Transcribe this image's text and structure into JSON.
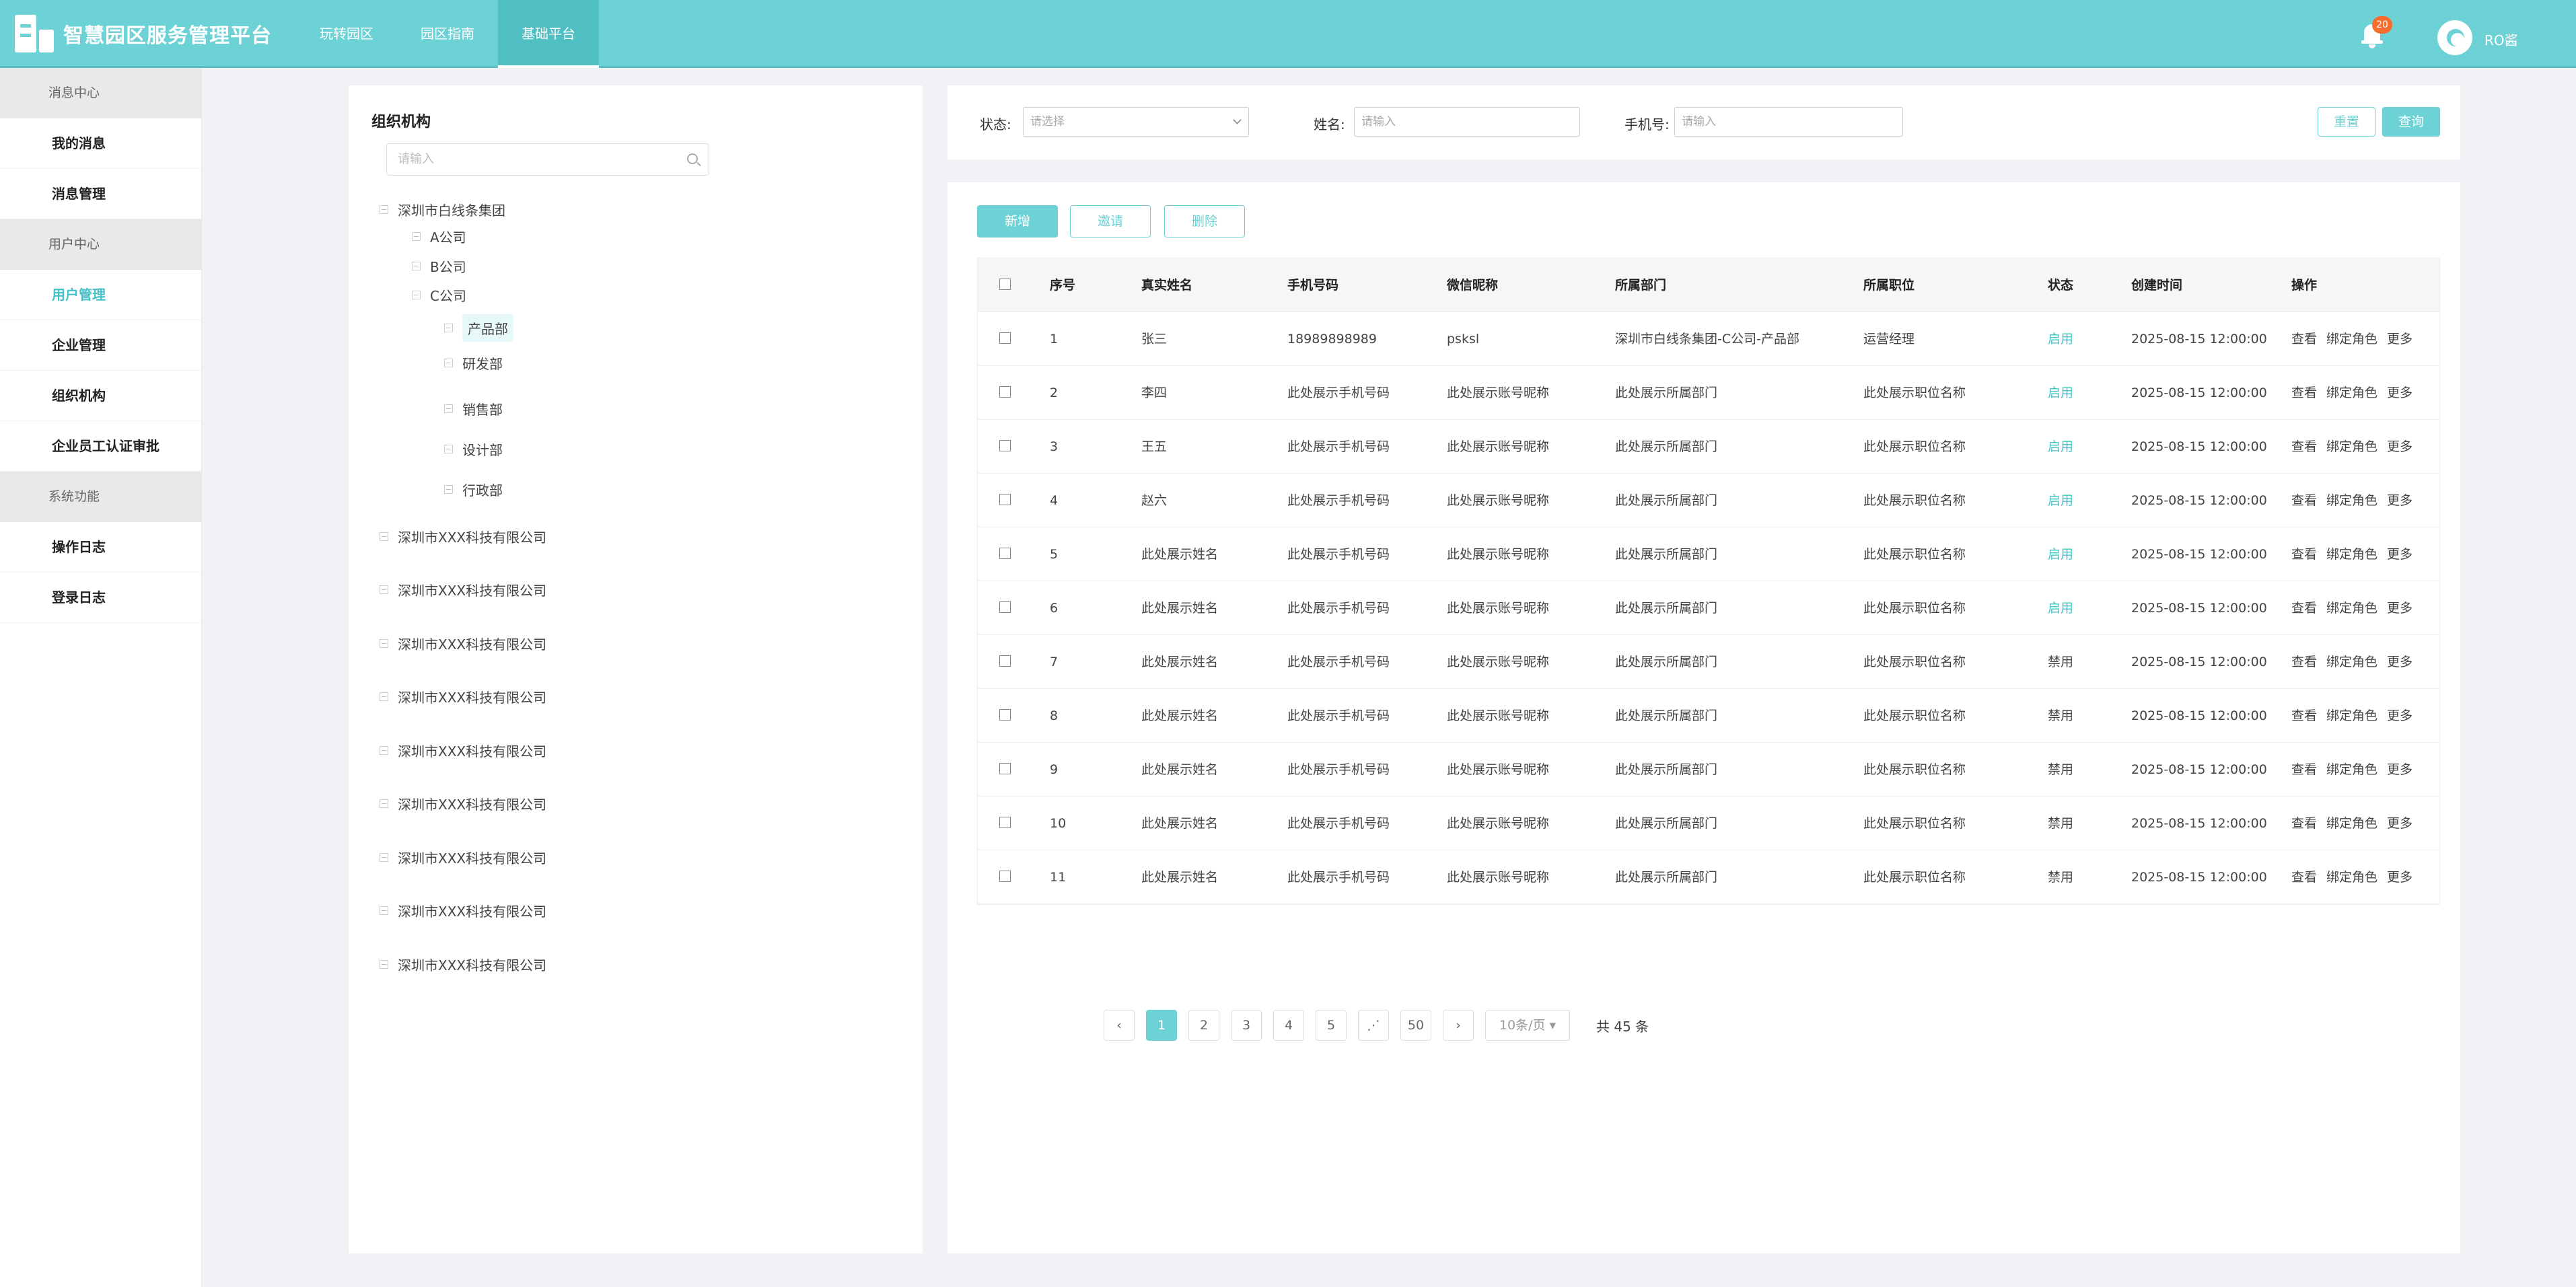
{
  "header": {
    "title": "智慧园区服务管理平台",
    "nav": [
      "玩转园区",
      "园区指南",
      "基础平台"
    ],
    "active_nav": 2,
    "notification_count": "20",
    "user_name": "RO酱",
    "accent_color": "#6dd2d6"
  },
  "sidebar": {
    "groups": [
      {
        "title": "消息中心",
        "items": [
          "我的消息",
          "消息管理"
        ]
      },
      {
        "title": "用户中心",
        "items": [
          "用户管理",
          "企业管理",
          "组织机构",
          "企业员工认证审批"
        ]
      },
      {
        "title": "系统功能",
        "items": [
          "操作日志",
          "登录日志"
        ]
      }
    ],
    "active_item": "用户管理"
  },
  "org": {
    "title": "组织机构",
    "search_placeholder": "请输入",
    "root": "深圳市白线条集团",
    "companies": [
      "A公司",
      "B公司",
      "C公司"
    ],
    "departments": [
      "产品部",
      "研发部",
      "销售部",
      "设计部",
      "行政部"
    ],
    "selected_department": "产品部",
    "other_orgs": [
      "深圳市XXX科技有限公司",
      "深圳市XXX科技有限公司",
      "深圳市XXX科技有限公司",
      "深圳市XXX科技有限公司",
      "深圳市XXX科技有限公司",
      "深圳市XXX科技有限公司",
      "深圳市XXX科技有限公司",
      "深圳市XXX科技有限公司",
      "深圳市XXX科技有限公司"
    ]
  },
  "filter": {
    "status_label": "状态:",
    "status_placeholder": "请选择",
    "name_label": "姓名:",
    "name_placeholder": "请输入",
    "phone_label": "手机号:",
    "phone_placeholder": "请输入",
    "reset_label": "重置",
    "query_label": "查询"
  },
  "toolbar": {
    "add_label": "新增",
    "invite_label": "邀请",
    "delete_label": "删除"
  },
  "table": {
    "columns": [
      "序号",
      "真实姓名",
      "手机号码",
      "微信昵称",
      "所属部门",
      "所属职位",
      "状态",
      "创建时间",
      "操作"
    ],
    "rows": [
      [
        "1",
        "张三",
        "18989898989",
        "psksl",
        "深圳市白线条集团-C公司-产品部",
        "运营经理",
        "启用",
        "2025-08-15 12:00:00"
      ],
      [
        "2",
        "李四",
        "此处展示手机号码",
        "此处展示账号昵称",
        "此处展示所属部门",
        "此处展示职位名称",
        "启用",
        "2025-08-15 12:00:00"
      ],
      [
        "3",
        "王五",
        "此处展示手机号码",
        "此处展示账号昵称",
        "此处展示所属部门",
        "此处展示职位名称",
        "启用",
        "2025-08-15 12:00:00"
      ],
      [
        "4",
        "赵六",
        "此处展示手机号码",
        "此处展示账号昵称",
        "此处展示所属部门",
        "此处展示职位名称",
        "启用",
        "2025-08-15 12:00:00"
      ],
      [
        "5",
        "此处展示姓名",
        "此处展示手机号码",
        "此处展示账号昵称",
        "此处展示所属部门",
        "此处展示职位名称",
        "启用",
        "2025-08-15 12:00:00"
      ],
      [
        "6",
        "此处展示姓名",
        "此处展示手机号码",
        "此处展示账号昵称",
        "此处展示所属部门",
        "此处展示职位名称",
        "启用",
        "2025-08-15 12:00:00"
      ],
      [
        "7",
        "此处展示姓名",
        "此处展示手机号码",
        "此处展示账号昵称",
        "此处展示所属部门",
        "此处展示职位名称",
        "禁用",
        "2025-08-15 12:00:00"
      ],
      [
        "8",
        "此处展示姓名",
        "此处展示手机号码",
        "此处展示账号昵称",
        "此处展示所属部门",
        "此处展示职位名称",
        "禁用",
        "2025-08-15 12:00:00"
      ],
      [
        "9",
        "此处展示姓名",
        "此处展示手机号码",
        "此处展示账号昵称",
        "此处展示所属部门",
        "此处展示职位名称",
        "禁用",
        "2025-08-15 12:00:00"
      ],
      [
        "10",
        "此处展示姓名",
        "此处展示手机号码",
        "此处展示账号昵称",
        "此处展示所属部门",
        "此处展示职位名称",
        "禁用",
        "2025-08-15 12:00:00"
      ],
      [
        "11",
        "此处展示姓名",
        "此处展示手机号码",
        "此处展示账号昵称",
        "此处展示所属部门",
        "此处展示职位名称",
        "禁用",
        "2025-08-15 12:00:00"
      ]
    ],
    "actions": [
      "查看",
      "绑定角色",
      "更多"
    ]
  },
  "pagination": {
    "prev": "‹",
    "pages": [
      "1",
      "2",
      "3",
      "4",
      "5"
    ],
    "ellipsis": "⋰",
    "last": "50",
    "next": "›",
    "current": "1",
    "page_size": "10条/页 ▾",
    "total": "共 45 条"
  }
}
